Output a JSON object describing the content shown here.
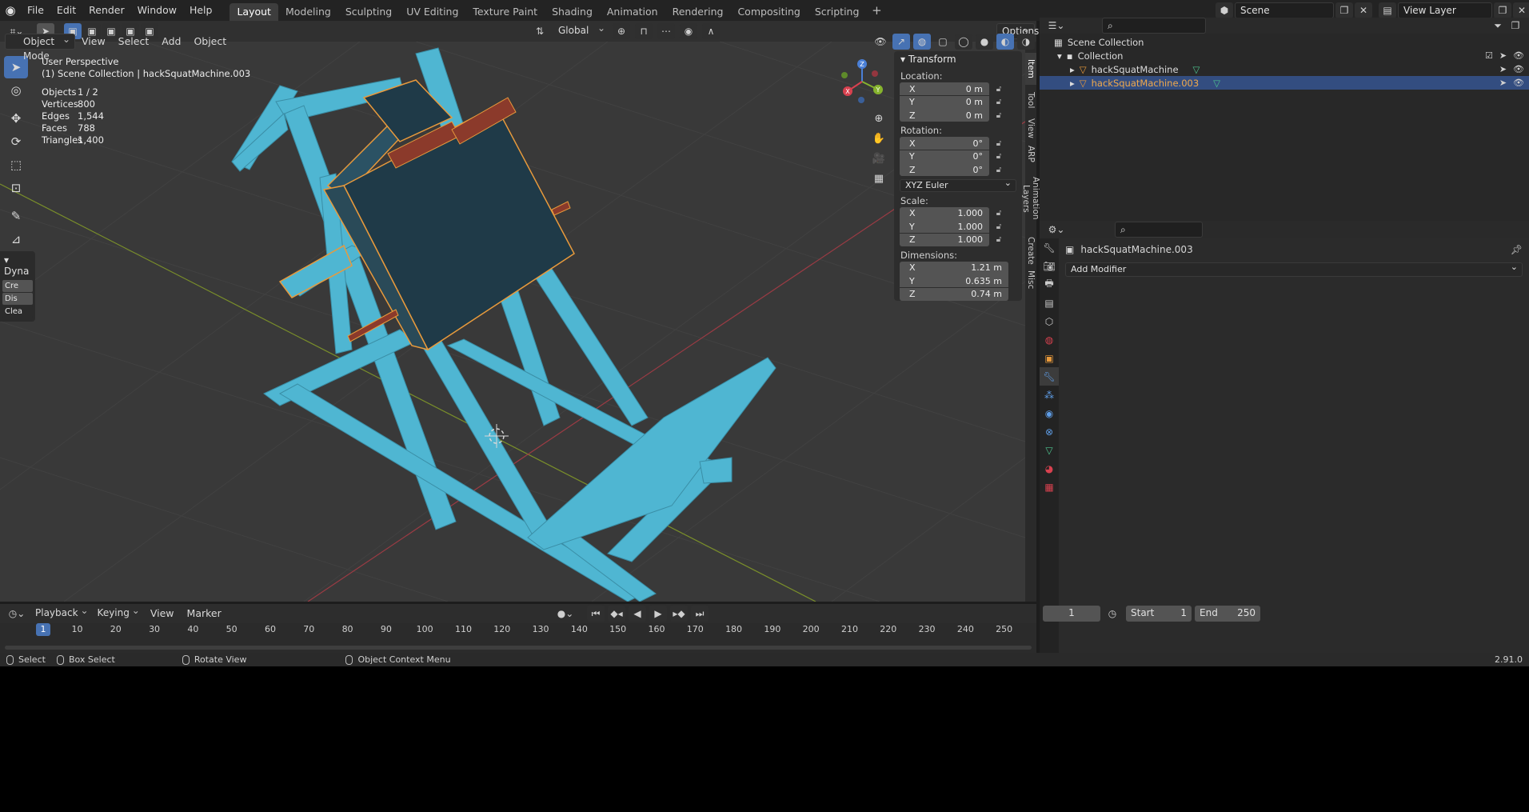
{
  "topbar": {
    "menus": [
      "File",
      "Edit",
      "Render",
      "Window",
      "Help"
    ],
    "workspaces": [
      "Layout",
      "Modeling",
      "Sculpting",
      "UV Editing",
      "Texture Paint",
      "Shading",
      "Animation",
      "Rendering",
      "Compositing",
      "Scripting"
    ],
    "active_workspace": "Layout",
    "scene": "Scene",
    "view_layer": "View Layer"
  },
  "viewport_header": {
    "mode": "Object Mode",
    "menus": [
      "View",
      "Select",
      "Add",
      "Object"
    ],
    "orientation": "Global",
    "options": "Options"
  },
  "viewport": {
    "view_name": "User Perspective",
    "collection_path": "(1) Scene Collection | hackSquatMachine.003",
    "stats": [
      {
        "k": "Objects",
        "v": "1 / 2"
      },
      {
        "k": "Vertices",
        "v": "800"
      },
      {
        "k": "Edges",
        "v": "1,544"
      },
      {
        "k": "Faces",
        "v": "788"
      },
      {
        "k": "Triangles",
        "v": "1,400"
      }
    ],
    "gizmo_axes": {
      "x": "X",
      "y": "Y",
      "z": "Z"
    },
    "dyna_panel": {
      "title": "Dyna",
      "buttons": [
        "Cre",
        "Dis"
      ],
      "clear": "Clea"
    }
  },
  "transform_panel": {
    "title": "Transform",
    "location_label": "Location:",
    "location": [
      {
        "axis": "X",
        "value": "0 m"
      },
      {
        "axis": "Y",
        "value": "0 m"
      },
      {
        "axis": "Z",
        "value": "0 m"
      }
    ],
    "rotation_label": "Rotation:",
    "rotation": [
      {
        "axis": "X",
        "value": "0°"
      },
      {
        "axis": "Y",
        "value": "0°"
      },
      {
        "axis": "Z",
        "value": "0°"
      }
    ],
    "rotation_mode": "XYZ Euler",
    "scale_label": "Scale:",
    "scale": [
      {
        "axis": "X",
        "value": "1.000"
      },
      {
        "axis": "Y",
        "value": "1.000"
      },
      {
        "axis": "Z",
        "value": "1.000"
      }
    ],
    "dimensions_label": "Dimensions:",
    "dimensions": [
      {
        "axis": "X",
        "value": "1.21 m"
      },
      {
        "axis": "Y",
        "value": "0.635 m"
      },
      {
        "axis": "Z",
        "value": "0.74 m"
      }
    ]
  },
  "side_tabs": [
    "Item",
    "Tool",
    "View",
    "ARP",
    "Animation Layers",
    "Create",
    "Misc"
  ],
  "outliner": {
    "scene_collection": "Scene Collection",
    "collection": "Collection",
    "objects": [
      "hackSquatMachine",
      "hackSquatMachine.003"
    ]
  },
  "properties": {
    "object_name": "hackSquatMachine.003",
    "add_modifier": "Add Modifier"
  },
  "timeline": {
    "menus": [
      "Playback",
      "Keying",
      "View",
      "Marker"
    ],
    "current_frame": "1",
    "start_label": "Start",
    "start": "1",
    "end_label": "End",
    "end": "250",
    "ruler_labels": [
      "10",
      "20",
      "30",
      "40",
      "50",
      "60",
      "70",
      "80",
      "90",
      "100",
      "110",
      "120",
      "130",
      "140",
      "150",
      "160",
      "170",
      "180",
      "190",
      "200",
      "210",
      "220",
      "230",
      "240",
      "250"
    ]
  },
  "statusbar": {
    "items": [
      "Select",
      "Box Select",
      "Rotate View",
      "Object Context Menu"
    ],
    "version": "2.91.0"
  },
  "colors": {
    "accent": "#4772b3",
    "selected_row": "#334d80",
    "machine": "#4fb6d2",
    "pad": "#1f3a48",
    "handle": "#8b3a2b",
    "selection_outline": "#e89a3c"
  }
}
